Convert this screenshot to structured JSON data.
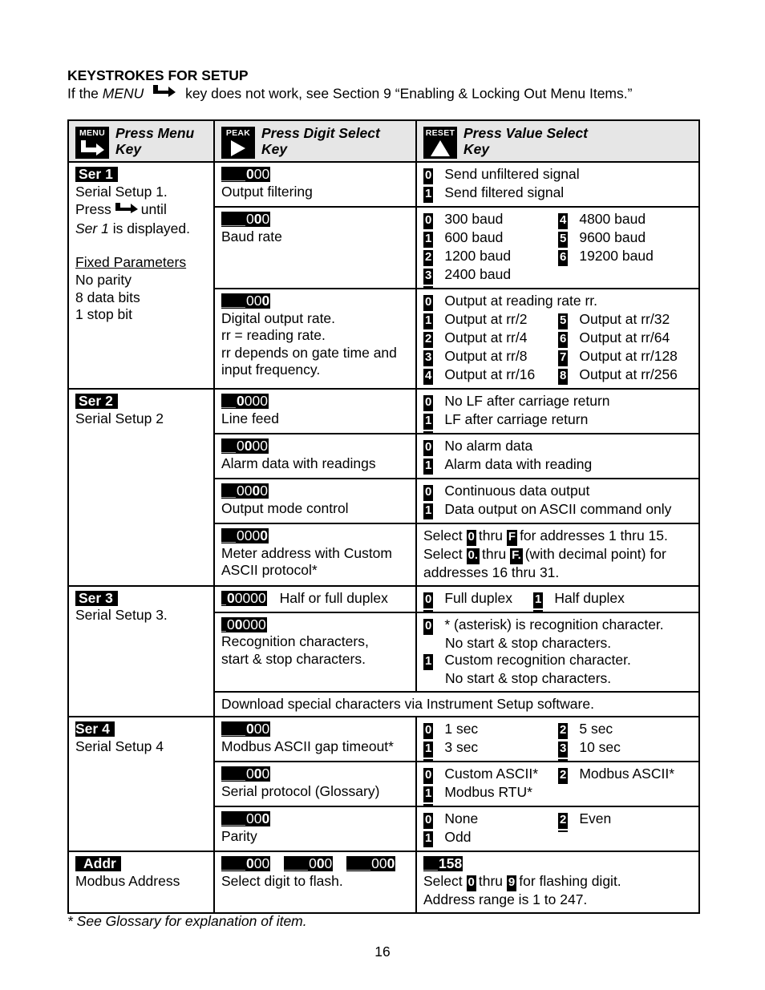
{
  "heading": "KEYSTROKES FOR SETUP",
  "intro": {
    "prefix": "If the",
    "menu_word": "MENU",
    "suffix": "key does not work, see Section 9 “Enabling & Locking Out Menu Items.”"
  },
  "table_header": [
    {
      "key_label": "MENU",
      "icon": "menu-arrow-icon",
      "title_line1": "Press Menu",
      "title_line2": "Key"
    },
    {
      "key_label": "PEAK",
      "icon": "right-triangle-icon",
      "title_line1": "Press Digit Select",
      "title_line2": "Key"
    },
    {
      "key_label": "RESET",
      "icon": "up-triangle-icon",
      "title_line1": "Press Value Select",
      "title_line2": "Key"
    }
  ],
  "sections": {
    "ser1": {
      "tag": "Ser 1",
      "lines": [
        "Serial Setup 1.",
        "Press",
        "until",
        "Ser 1",
        "is displayed."
      ],
      "fixed_title": "Fixed Parameters",
      "fixed": [
        "No parity",
        "8 data bits",
        "1 stop bit"
      ],
      "rows": [
        {
          "display": {
            "pre": "",
            "digits": [
              "0",
              "0",
              "0"
            ],
            "hl": 0
          },
          "label": [
            "Output filtering"
          ],
          "options": [
            {
              "code": "0",
              "text": "Send unfiltered signal"
            },
            {
              "code": "1",
              "text": "Send filtered signal"
            }
          ]
        },
        {
          "display": {
            "pre": "",
            "digits": [
              "0",
              "0",
              "0"
            ],
            "hl": 1
          },
          "label": [
            "Baud rate"
          ],
          "options_left": [
            {
              "code": "0",
              "text": "300 baud"
            },
            {
              "code": "1",
              "text": "600 baud"
            },
            {
              "code": "2",
              "text": "1200 baud"
            },
            {
              "code": "3",
              "text": "2400 baud"
            }
          ],
          "options_right": [
            {
              "code": "4",
              "text": "4800 baud"
            },
            {
              "code": "5",
              "text": "9600 baud"
            },
            {
              "code": "6",
              "text": "19200 baud"
            }
          ]
        },
        {
          "display": {
            "pre": "",
            "digits": [
              "0",
              "0",
              "0"
            ],
            "hl": 2
          },
          "label": [
            "Digital output rate.",
            "rr = reading rate.",
            "rr depends on gate time and",
            "input frequency."
          ],
          "option_first": {
            "code": "0",
            "text": "Output at reading rate rr."
          },
          "options_left": [
            {
              "code": "1",
              "text": "Output at rr/2"
            },
            {
              "code": "2",
              "text": "Output at rr/4"
            },
            {
              "code": "3",
              "text": "Output at rr/8"
            },
            {
              "code": "4",
              "text": "Output at rr/16"
            }
          ],
          "options_right": [
            {
              "code": "5",
              "text": "Output at rr/32"
            },
            {
              "code": "6",
              "text": "Output at rr/64"
            },
            {
              "code": "7",
              "text": "Output at rr/128"
            },
            {
              "code": "8",
              "text": "Output at rr/256"
            }
          ]
        }
      ]
    },
    "ser2": {
      "tag": "Ser 2",
      "lines": [
        "Serial Setup 2"
      ],
      "rows": [
        {
          "display": {
            "pre": "",
            "digits": [
              "0",
              "0",
              "0",
              "0"
            ],
            "hl": 0
          },
          "label": [
            "Line feed"
          ],
          "options": [
            {
              "code": "0",
              "text": "No LF after carriage return"
            },
            {
              "code": "1",
              "text": "LF after carriage return"
            }
          ]
        },
        {
          "display": {
            "pre": "",
            "digits": [
              "0",
              "0",
              "0",
              "0"
            ],
            "hl": 1
          },
          "label": [
            "Alarm data with readings"
          ],
          "options": [
            {
              "code": "0",
              "text": "No alarm data"
            },
            {
              "code": "1",
              "text": "Alarm data with reading"
            }
          ]
        },
        {
          "display": {
            "pre": "",
            "digits": [
              "0",
              "0",
              "0",
              "0"
            ],
            "hl": 2
          },
          "label": [
            "Output mode control"
          ],
          "options": [
            {
              "code": "0",
              "text": "Continuous data output"
            },
            {
              "code": "1",
              "text": "Data output on ASCII command only"
            }
          ]
        },
        {
          "display": {
            "pre": "",
            "digits": [
              "0",
              "0",
              "0",
              "0"
            ],
            "hl": 3
          },
          "label": [
            "Meter address with Custom",
            "ASCII protocol*"
          ],
          "select_text": {
            "l1_a": "Select",
            "l1_c1": "0",
            "l1_b": "thru",
            "l1_c2": "F",
            "l1_c": "for addresses 1 thru 15.",
            "l2_a": "Select",
            "l2_c1": "0.",
            "l2_b": "thru",
            "l2_c2": "F.",
            "l2_c": "(with decimal point) for",
            "l3": "addresses 16 thru 31."
          }
        }
      ]
    },
    "ser3": {
      "tag": "Ser 3",
      "lines": [
        "Serial Setup 3."
      ],
      "rows": [
        {
          "display": {
            "pre": "",
            "digits": [
              "0",
              "0",
              "0",
              "0",
              "0"
            ],
            "hl": 0
          },
          "label_inline": "Half or full duplex",
          "options": [
            {
              "code": "0",
              "text": "Full duplex"
            },
            {
              "code": "1",
              "text": "Half duplex"
            }
          ]
        },
        {
          "display": {
            "pre": "",
            "digits": [
              "0",
              "0",
              "0",
              "0",
              "0"
            ],
            "hl": 1
          },
          "label": [
            "Recognition characters,",
            "start & stop characters."
          ],
          "options_multi": [
            {
              "code": "0",
              "lines": [
                "* (asterisk) is recognition character.",
                "No start & stop characters."
              ]
            },
            {
              "code": "1",
              "lines": [
                "Custom recognition character.",
                "No start & stop characters."
              ]
            }
          ]
        }
      ],
      "note": "Download special characters via Instrument Setup software."
    },
    "ser4": {
      "tag": "Ser 4",
      "lines": [
        "Serial Setup 4"
      ],
      "rows": [
        {
          "display": {
            "pre": "",
            "digits": [
              "0",
              "0",
              "0"
            ],
            "hl": 0
          },
          "label": [
            "Modbus ASCII gap timeout*"
          ],
          "options_left": [
            {
              "code": "0",
              "text": "1 sec"
            },
            {
              "code": "1",
              "text": "3 sec"
            }
          ],
          "options_right": [
            {
              "code": "2",
              "text": "5 sec"
            },
            {
              "code": "3",
              "text": "10 sec"
            }
          ]
        },
        {
          "display": {
            "pre": "",
            "digits": [
              "0",
              "0",
              "0"
            ],
            "hl": 1
          },
          "label": [
            "Serial protocol (Glossary)"
          ],
          "options_left": [
            {
              "code": "0",
              "text": "Custom ASCII*"
            },
            {
              "code": "1",
              "text": "Modbus RTU*"
            }
          ],
          "options_right": [
            {
              "code": "2",
              "text": "Modbus ASCII*"
            }
          ]
        },
        {
          "display": {
            "pre": "",
            "digits": [
              "0",
              "0",
              "0"
            ],
            "hl": 2
          },
          "label": [
            "Parity"
          ],
          "options_left": [
            {
              "code": "0",
              "text": "None"
            },
            {
              "code": "1",
              "text": "Odd"
            }
          ],
          "options_right": [
            {
              "code": "2",
              "text": "Even"
            }
          ]
        }
      ]
    },
    "addr": {
      "tag": "Addr",
      "lines": [
        "Modbus Address"
      ],
      "displays": [
        {
          "digits": [
            "0",
            "0",
            "0"
          ],
          "hl": 0
        },
        {
          "digits": [
            "0",
            "0",
            "0"
          ],
          "hl": 1
        },
        {
          "digits": [
            "0",
            "0",
            "0"
          ],
          "hl": 2
        }
      ],
      "label": "Select digit to flash.",
      "value_display": {
        "digits": [
          "1",
          "5",
          "8"
        ]
      },
      "value_text": {
        "a": "Select",
        "c1": "0",
        "b": "thru",
        "c2": "9",
        "c": "for flashing digit.",
        "l2": "Address range is 1 to 247."
      }
    }
  },
  "footnote": "* See Glossary for explanation of item.",
  "page_number": "16"
}
